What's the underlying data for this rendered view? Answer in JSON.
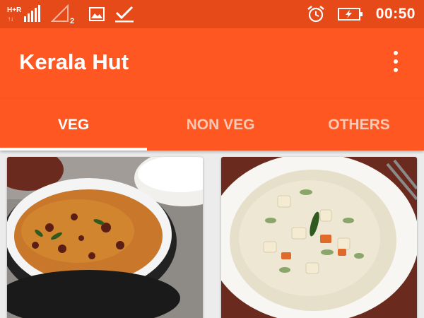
{
  "status_bar": {
    "network_label": "H+R",
    "sim_slot": "2",
    "time": "00:50",
    "icons": [
      "signal-icon",
      "sim-signal-icon",
      "image-notification-icon",
      "download-done-icon",
      "alarm-icon",
      "battery-charging-icon"
    ]
  },
  "app_bar": {
    "title": "Kerala Hut",
    "menu_icon": "more-vert-icon"
  },
  "tabs": [
    {
      "label": "VEG",
      "active": true
    },
    {
      "label": "NON VEG",
      "active": false
    },
    {
      "label": "OTHERS",
      "active": false
    }
  ],
  "colors": {
    "status_bar": "#E64A19",
    "primary": "#FF5722",
    "tab_inactive_text": "#FFC8B3",
    "background": "#ECECEC"
  },
  "cards": [
    {
      "image": "kadala-curry-photo"
    },
    {
      "image": "vegetable-stew-photo"
    }
  ]
}
